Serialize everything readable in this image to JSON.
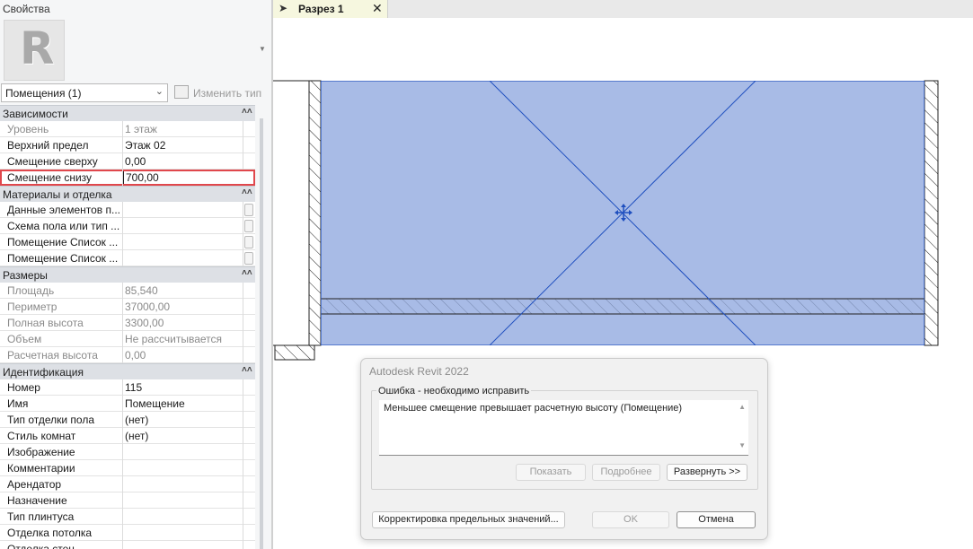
{
  "properties": {
    "title": "Свойства",
    "logo_letter": "R",
    "type_selector": "Помещения (1)",
    "edit_type_label": "Изменить тип",
    "sections": [
      {
        "title": "Зависимости",
        "rows": [
          {
            "name": "Уровень",
            "value": "1 этаж",
            "readonly": true
          },
          {
            "name": "Верхний предел",
            "value": "Этаж 02"
          },
          {
            "name": "Смещение сверху",
            "value": "0,00"
          },
          {
            "name": "Смещение снизу",
            "value": "700,00",
            "highlight": true
          }
        ]
      },
      {
        "title": "Материалы и отделка",
        "rows": [
          {
            "name": "Данные элементов п...",
            "value": "",
            "button": true
          },
          {
            "name": "Схема пола или тип ...",
            "value": "",
            "button": true
          },
          {
            "name": "Помещение Список ...",
            "value": "",
            "button": true
          },
          {
            "name": "Помещение Список ...",
            "value": "",
            "button": true
          }
        ]
      },
      {
        "title": "Размеры",
        "rows": [
          {
            "name": "Площадь",
            "value": "85,540",
            "readonly": true
          },
          {
            "name": "Периметр",
            "value": "37000,00",
            "readonly": true
          },
          {
            "name": "Полная высота",
            "value": "3300,00",
            "readonly": true
          },
          {
            "name": "Объем",
            "value": "Не рассчитывается",
            "readonly": true
          },
          {
            "name": "Расчетная высота",
            "value": "0,00",
            "readonly": true
          }
        ]
      },
      {
        "title": "Идентификация",
        "rows": [
          {
            "name": "Номер",
            "value": "115"
          },
          {
            "name": "Имя",
            "value": "Помещение"
          },
          {
            "name": "Тип отделки пола",
            "value": "(нет)"
          },
          {
            "name": "Стиль комнат",
            "value": "(нет)"
          },
          {
            "name": "Изображение",
            "value": ""
          },
          {
            "name": "Комментарии",
            "value": ""
          },
          {
            "name": "Арендатор",
            "value": ""
          },
          {
            "name": "Назначение",
            "value": ""
          },
          {
            "name": "Тип плинтуса",
            "value": ""
          },
          {
            "name": "Отделка потолка",
            "value": ""
          },
          {
            "name": "Отделка стен",
            "value": ""
          }
        ]
      }
    ]
  },
  "view": {
    "tab_label": "Разрез 1",
    "room_fill_color": "#a8bbe6",
    "line_color": "#1f4fbf"
  },
  "dialog": {
    "title": "Autodesk Revit 2022",
    "group_label": "Ошибка - необходимо исправить",
    "message": "Меньшее смещение превышает расчетную высоту (Помещение)",
    "show_button": "Показать",
    "details_button": "Подробнее",
    "expand_button": "Развернуть >>",
    "fix_button": "Корректировка предельных значений...",
    "ok_button": "OK",
    "cancel_button": "Отмена"
  }
}
